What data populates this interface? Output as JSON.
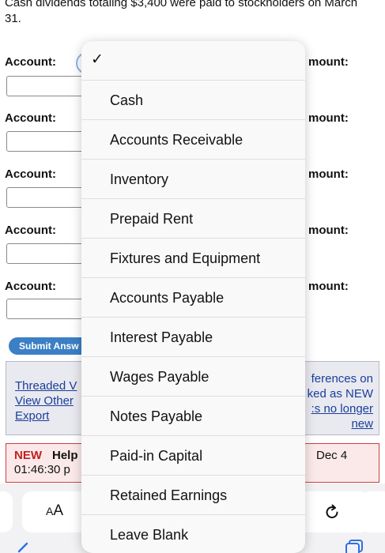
{
  "question": {
    "text": "Cash dividends totaling $3,400 were paid to stockholders on March 31."
  },
  "form": {
    "rows": [
      {
        "account_label": "Account:",
        "amount_label": "mount:"
      },
      {
        "account_label": "Account:",
        "amount_label": "mount:"
      },
      {
        "account_label": "Account:",
        "amount_label": "mount:"
      },
      {
        "account_label": "Account:",
        "amount_label": "mount:"
      },
      {
        "account_label": "Account:",
        "amount_label": "mount:"
      }
    ],
    "submit_label": "Submit Answ"
  },
  "forum": {
    "link1": "Threaded V",
    "link2": "View  Other",
    "link3": "Export",
    "right1": "ferences on",
    "right2": "ked as NEW",
    "right3": ":s no longer",
    "right4": "new"
  },
  "new_post": {
    "badge": "NEW",
    "title": "Help",
    "time": "01:46:30 p",
    "date": "Dec 4"
  },
  "browser": {
    "aa_small": "A",
    "aa_large": "A",
    "icons": [
      "back-arrow-icon",
      "reload-icon",
      "tabs-icon"
    ]
  },
  "dropdown": {
    "checkmark": "✓",
    "options": [
      "",
      "Cash",
      "Accounts Receivable",
      "Inventory",
      "Prepaid Rent",
      "Fixtures and Equipment",
      "Accounts Payable",
      "Interest Payable",
      "Wages Payable",
      "Notes Payable",
      "Paid-in Capital",
      "Retained Earnings",
      "Leave Blank"
    ],
    "selected_index": 0
  }
}
